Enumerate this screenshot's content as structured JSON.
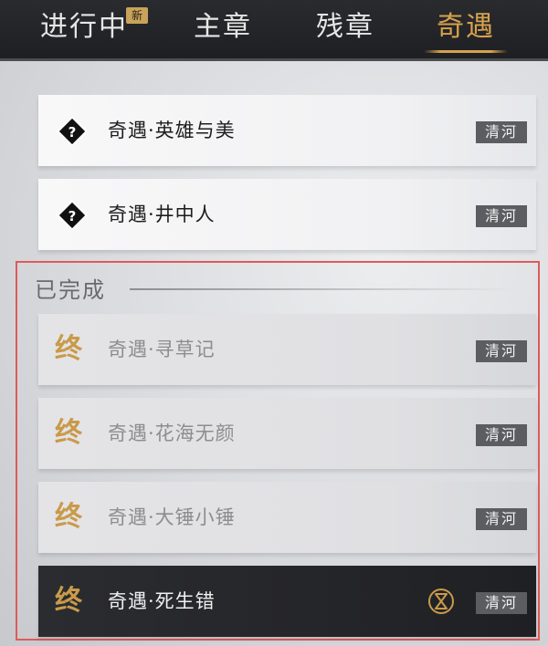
{
  "tabs": [
    {
      "label": "进行中",
      "badge": "新"
    },
    {
      "label": "主章"
    },
    {
      "label": "残章"
    },
    {
      "label": "奇遇",
      "active": true
    }
  ],
  "active_quests": [
    {
      "title": "奇遇·英雄与美",
      "region": "清河",
      "icon": "question-diamond-icon"
    },
    {
      "title": "奇遇·井中人",
      "region": "清河",
      "icon": "question-diamond-icon"
    }
  ],
  "completed": {
    "label": "已完成",
    "end_glyph": "终",
    "items": [
      {
        "title": "奇遇·寻草记",
        "region": "清河"
      },
      {
        "title": "奇遇·花海无颜",
        "region": "清河"
      },
      {
        "title": "奇遇·大锤小锤",
        "region": "清河"
      },
      {
        "title": "奇遇·死生错",
        "region": "清河",
        "selected": true,
        "extra_icon": "hourglass-icon"
      }
    ]
  },
  "colors": {
    "accent_gold": "#d7a24f",
    "highlight_border": "#e05a5a",
    "tab_bar_bg": "#1e1f22",
    "region_tag_bg": "#5c5d60"
  }
}
